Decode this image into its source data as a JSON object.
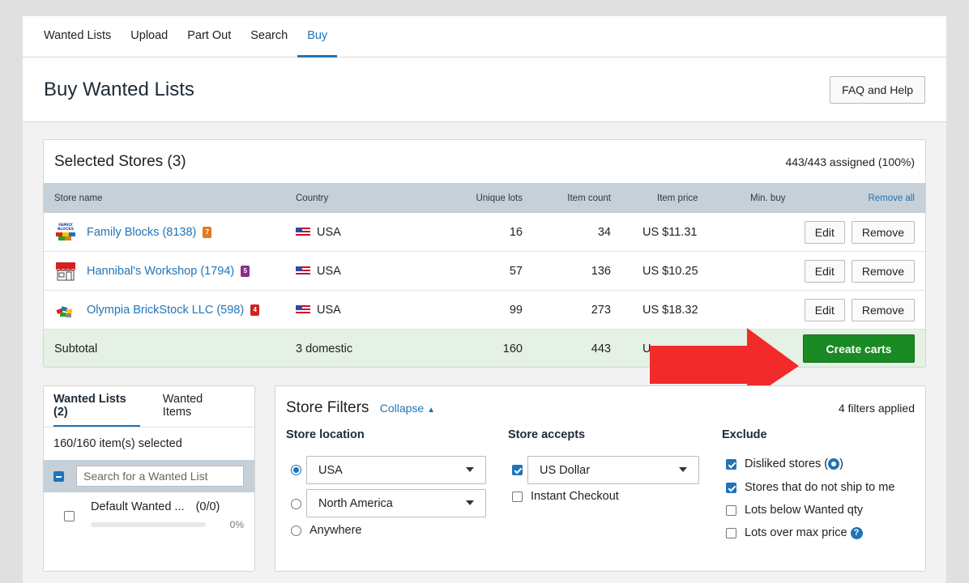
{
  "nav": {
    "tabs": [
      {
        "label": "Wanted Lists"
      },
      {
        "label": "Upload"
      },
      {
        "label": "Part Out"
      },
      {
        "label": "Search"
      },
      {
        "label": "Buy"
      }
    ],
    "active_tab": "Buy"
  },
  "header": {
    "title": "Buy Wanted Lists",
    "faq_label": "FAQ and Help"
  },
  "stores": {
    "title": "Selected Stores (3)",
    "assigned": "443/443 assigned (100%)",
    "columns": {
      "name": "Store name",
      "country": "Country",
      "lots": "Unique lots",
      "items": "Item count",
      "price": "Item price",
      "min": "Min. buy",
      "remove_all": "Remove all"
    },
    "rows": [
      {
        "name": "Family Blocks (8138)",
        "country": "USA",
        "lots": "16",
        "items": "34",
        "price": "US $11.31",
        "badge": "7",
        "badge_color": "#e07b22"
      },
      {
        "name": "Hannibal's Workshop (1794)",
        "country": "USA",
        "lots": "57",
        "items": "136",
        "price": "US $10.25",
        "badge": "5",
        "badge_color": "#8a2f8a"
      },
      {
        "name": "Olympia BrickStock LLC (598)",
        "country": "USA",
        "lots": "99",
        "items": "273",
        "price": "US $18.32",
        "badge": "4",
        "badge_color": "#d42020"
      }
    ],
    "edit_label": "Edit",
    "remove_label": "Remove",
    "subtotal": {
      "label": "Subtotal",
      "country": "3 domestic",
      "lots": "160",
      "items": "443",
      "price_partial": "U"
    },
    "create_label": "Create carts"
  },
  "lists_panel": {
    "tab_lists": "Wanted Lists (2)",
    "tab_items": "Wanted Items",
    "selected": "160/160 item(s) selected",
    "search_placeholder": "Search for a Wanted List",
    "items": [
      {
        "name": "Default Wanted ...",
        "count": "(0/0)",
        "pct": "0%"
      }
    ]
  },
  "filters": {
    "title": "Store Filters",
    "collapse": "Collapse",
    "applied": "4 filters applied",
    "location": {
      "heading": "Store location",
      "select_usa": "USA",
      "select_region": "North America",
      "anywhere": "Anywhere"
    },
    "accepts": {
      "heading": "Store accepts",
      "currency": "US Dollar",
      "instant": "Instant Checkout"
    },
    "exclude": {
      "heading": "Exclude",
      "disliked": "Disliked stores (",
      "disliked_end": ")",
      "no_ship": "Stores that do not ship to me",
      "below_qty": "Lots below Wanted qty",
      "over_price": "Lots over max price"
    }
  },
  "colors": {
    "accent": "#1f74b8",
    "create_button": "#1a8a24",
    "arrow": "#f22a2a"
  }
}
